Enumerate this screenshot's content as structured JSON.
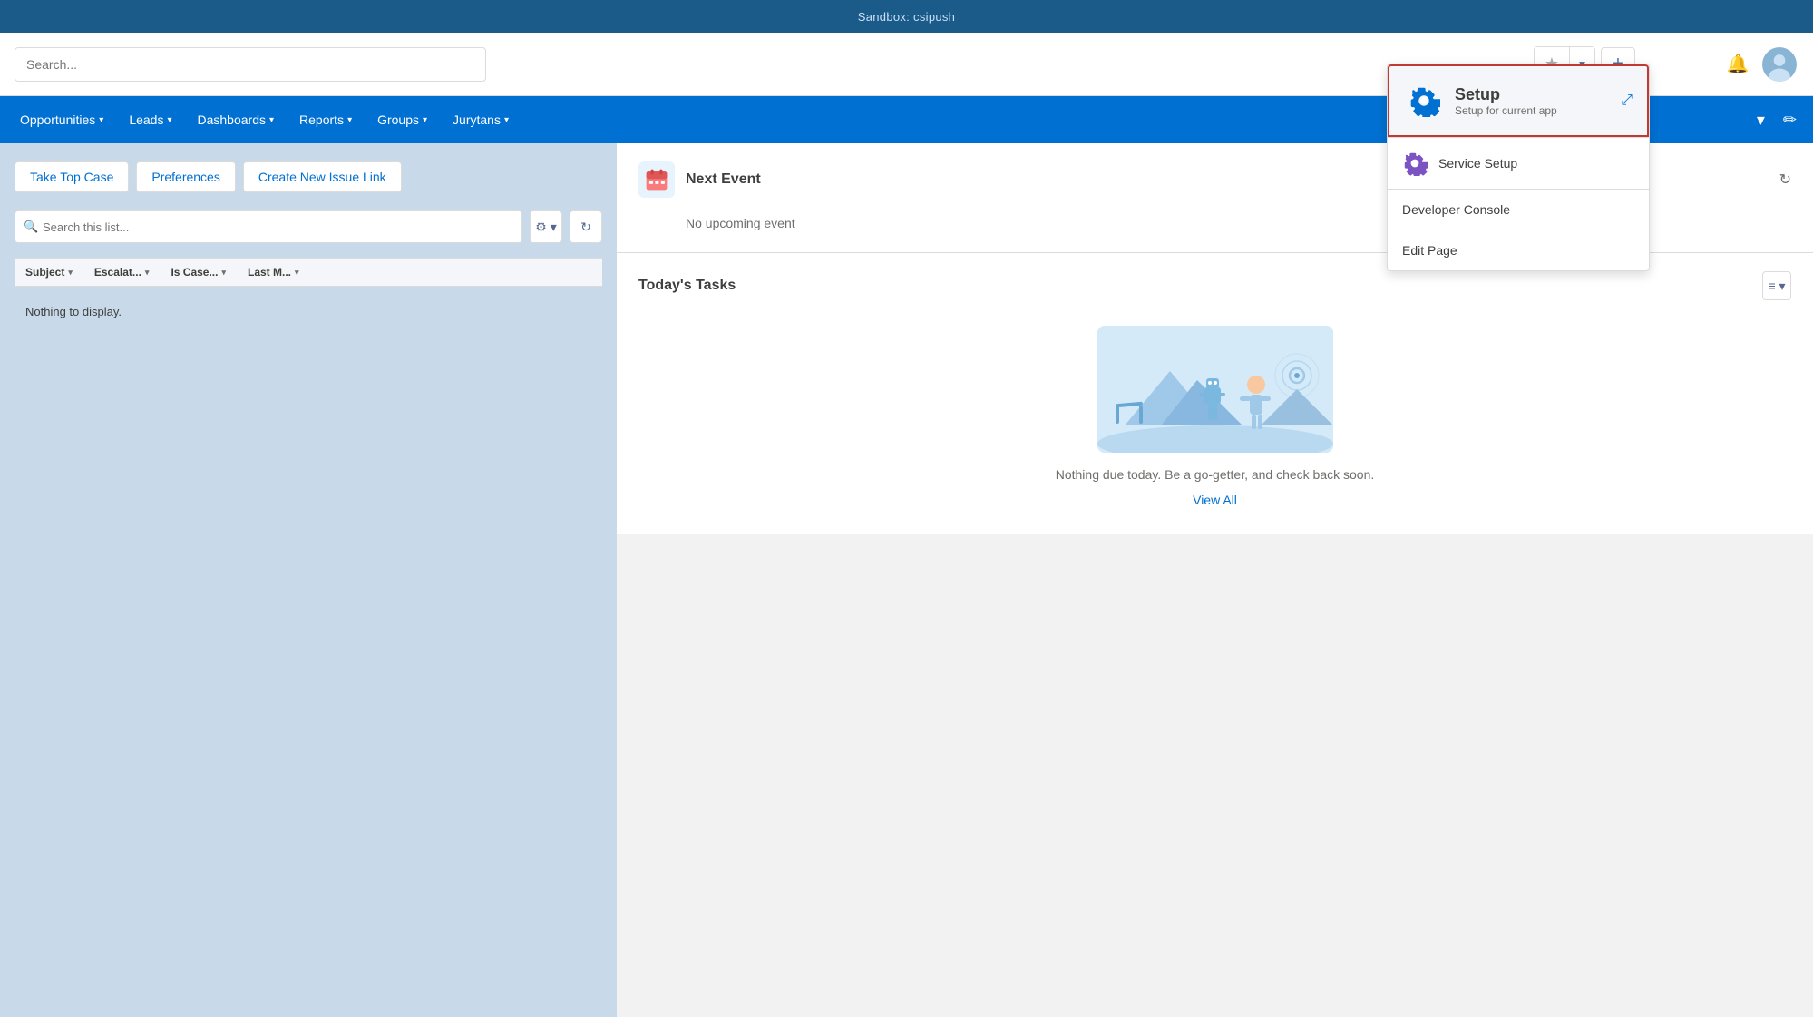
{
  "topbar": {
    "title": "Sandbox: csipush"
  },
  "header": {
    "search_placeholder": "Search...",
    "actions": {
      "star": "★",
      "dropdown": "▾",
      "add": "+",
      "help": "?",
      "bell": "🔔"
    }
  },
  "nav": {
    "items": [
      {
        "label": "Opportunities",
        "id": "opportunities"
      },
      {
        "label": "Leads",
        "id": "leads"
      },
      {
        "label": "Dashboards",
        "id": "dashboards"
      },
      {
        "label": "Reports",
        "id": "reports"
      },
      {
        "label": "Groups",
        "id": "groups"
      },
      {
        "label": "Jurytans",
        "id": "jurytans"
      }
    ]
  },
  "left_panel": {
    "buttons": [
      {
        "label": "Take Top Case",
        "id": "take-top-case"
      },
      {
        "label": "Preferences",
        "id": "preferences"
      },
      {
        "label": "Create New Issue Link",
        "id": "create-issue-link"
      }
    ],
    "search_placeholder": "Search this list...",
    "columns": [
      {
        "label": "Subject",
        "id": "subject"
      },
      {
        "label": "Escalat...",
        "id": "escalation"
      },
      {
        "label": "Is Case...",
        "id": "is-case"
      },
      {
        "label": "Last M...",
        "id": "last-modified"
      }
    ],
    "no_display_text": "Nothing to display."
  },
  "right_panel": {
    "next_event": {
      "title": "Next Event",
      "no_event_text": "No upcoming event"
    },
    "tasks": {
      "title": "Today's Tasks",
      "no_tasks_text": "Nothing due today. Be a go-getter, and check back soon.",
      "view_all": "View All"
    }
  },
  "dropdown": {
    "setup": {
      "title": "Setup",
      "subtitle": "Setup for current app"
    },
    "items": [
      {
        "label": "Service Setup",
        "id": "service-setup"
      },
      {
        "label": "Developer Console",
        "id": "developer-console"
      },
      {
        "label": "Edit Page",
        "id": "edit-page"
      }
    ]
  }
}
